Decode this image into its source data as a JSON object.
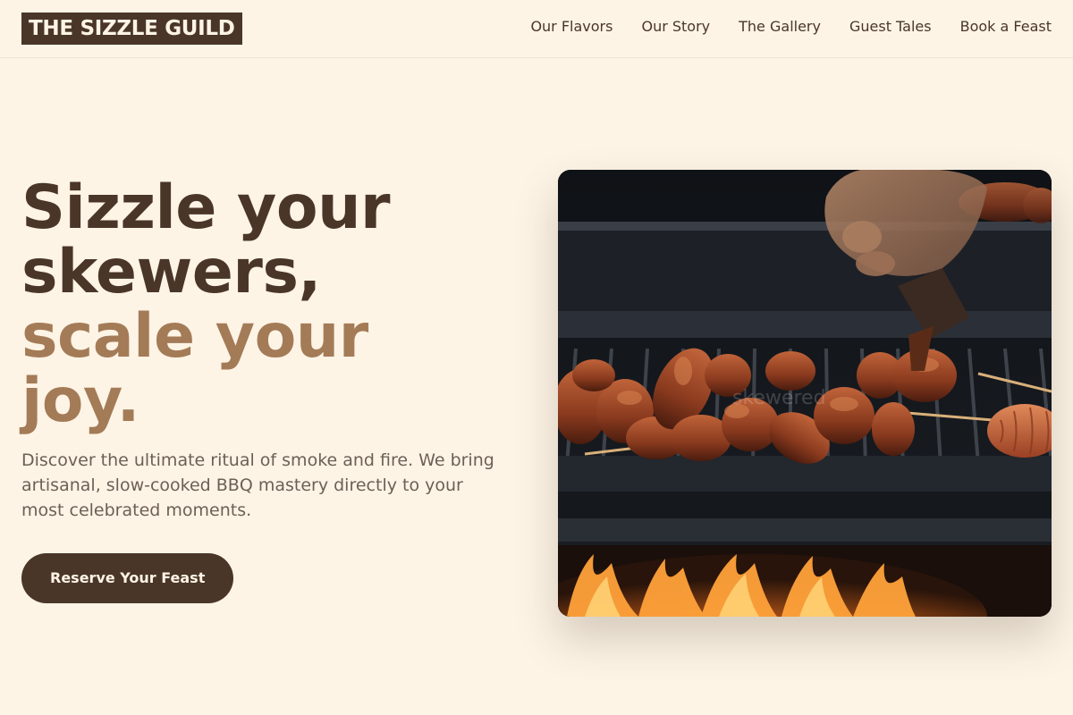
{
  "brand": {
    "name": "THE SIZZLE GUILD"
  },
  "nav": {
    "items": [
      {
        "label": "Our Flavors"
      },
      {
        "label": "Our Story"
      },
      {
        "label": "The Gallery"
      },
      {
        "label": "Guest Tales"
      },
      {
        "label": "Book a Feast"
      }
    ]
  },
  "hero": {
    "headline_line1": "Sizzle your",
    "headline_line2": "skewers,",
    "headline_line3": "scale your",
    "headline_line4": "joy.",
    "description": "Discover the ultimate ritual of smoke and fire. We bring artisanal, slow-cooked BBQ mastery directly to your most celebrated moments.",
    "cta_label": "Reserve Your Feast",
    "image_watermark": "skewered"
  },
  "colors": {
    "background": "#fdf4e6",
    "primary": "#4a3629",
    "accent": "#a47b57",
    "muted_text": "#6e5f55"
  }
}
